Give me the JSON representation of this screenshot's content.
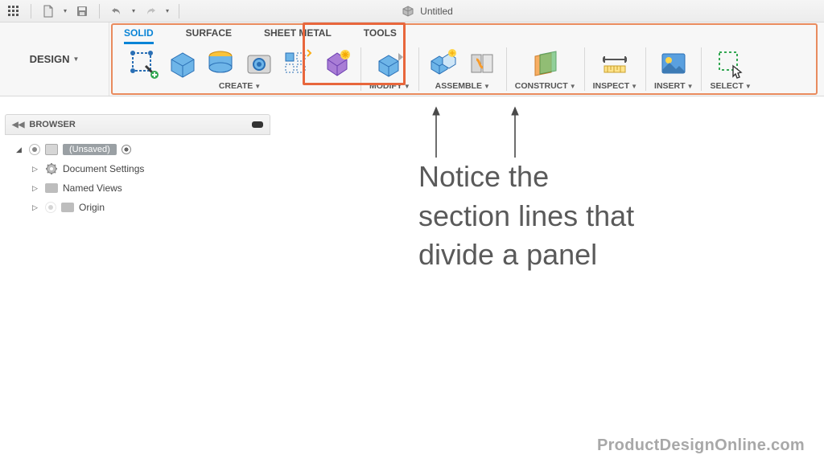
{
  "appbar": {
    "title": "Untitled"
  },
  "workspace": {
    "label": "DESIGN"
  },
  "tabs": {
    "solid": "SOLID",
    "surface": "SURFACE",
    "sheetmetal": "SHEET METAL",
    "tools": "TOOLS"
  },
  "panels": {
    "create": "CREATE",
    "modify": "MODIFY",
    "assemble": "ASSEMBLE",
    "construct": "CONSTRUCT",
    "inspect": "INSPECT",
    "insert": "INSERT",
    "select": "SELECT"
  },
  "browser": {
    "title": "BROWSER",
    "root": "(Unsaved)",
    "items": [
      "Document Settings",
      "Named Views",
      "Origin"
    ]
  },
  "annotation": {
    "line1": "Notice the",
    "line2": "section lines that",
    "line3": "divide a panel"
  },
  "watermark": "ProductDesignOnline.com"
}
